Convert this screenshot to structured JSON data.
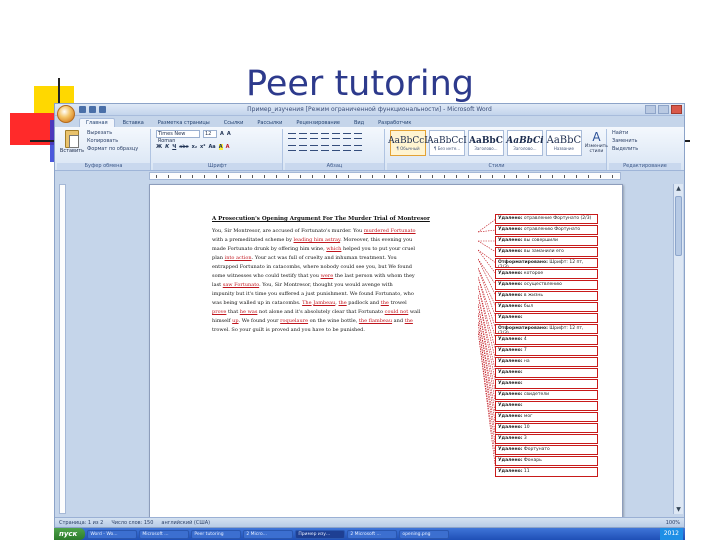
{
  "slide": {
    "title": "Peer tutoring"
  },
  "window": {
    "title": "Пример_изучения [Режим ограниченной функциональности] - Microsoft Word"
  },
  "ribbon": {
    "tabs": [
      "Главная",
      "Вставка",
      "Разметка страницы",
      "Ссылки",
      "Рассылки",
      "Рецензирование",
      "Вид",
      "Разработчик"
    ],
    "clipboard": {
      "paste": "Вставить",
      "cut": "Вырезать",
      "copy": "Копировать",
      "format_painter": "Формат по образцу",
      "label": "Буфер обмена"
    },
    "font": {
      "name": "Times New Roman",
      "size": "12",
      "format_buttons": [
        "Ж",
        "К",
        "Ч",
        "abe",
        "x₂",
        "x²",
        "Аа",
        "A"
      ],
      "label": "Шрифт"
    },
    "paragraph": {
      "label": "Абзац"
    },
    "styles": {
      "items": [
        {
          "sample": "AaBbCcI",
          "name": "¶ Обычный"
        },
        {
          "sample": "AaBbCcI",
          "name": "¶ Без инте..."
        },
        {
          "sample": "AaBbC",
          "name": "Заголово..."
        },
        {
          "sample": "AaBbCi",
          "name": "Заголово..."
        },
        {
          "sample": "AaBbC",
          "name": "Название"
        }
      ],
      "change_styles": "Изменить стили",
      "label": "Стили"
    },
    "editing": {
      "find": "Найти",
      "replace": "Заменить",
      "select": "Выделить",
      "label": "Редактирование"
    }
  },
  "document": {
    "heading": "A Prosecution's Opening Argument For The Murder Trial of Montresor",
    "lines": [
      [
        {
          "t": "You, Sir Montresor, are accused of Fortunato's murder. You "
        },
        {
          "t": "murdered Fortunato",
          "red": true
        }
      ],
      [
        {
          "t": "with a premeditated scheme by "
        },
        {
          "t": "leading him astray",
          "red": true
        },
        {
          "t": ". Moreover, this evening you"
        }
      ],
      [
        {
          "t": "made Fortunato drunk by offering him wine, "
        },
        {
          "t": "which",
          "red": true
        },
        {
          "t": " helped you to put your cruel"
        }
      ],
      [
        {
          "t": "plan "
        },
        {
          "t": "into action",
          "red": true
        },
        {
          "t": ". Your act was full of cruelty and inhuman treatment. You"
        }
      ],
      [
        {
          "t": "entrapped Fortunato in catacombs, where nobody could see you, but We found"
        }
      ],
      [
        {
          "t": "some witnesses who could testify that you "
        },
        {
          "t": "were",
          "red": true
        },
        {
          "t": " the last person with whom they"
        }
      ],
      [
        {
          "t": "last "
        },
        {
          "t": "saw Fortunato",
          "red": true
        },
        {
          "t": ". You, Sir Montresor, thought you would avenge with"
        }
      ],
      [
        {
          "t": "impunity but it's time you suffered a just punishment. We found Fortunato, who"
        }
      ],
      [
        {
          "t": "was being walled up in catacombs. "
        },
        {
          "t": "The",
          "red": true
        },
        {
          "t": " "
        },
        {
          "t": "Jambeau",
          "red": true
        },
        {
          "t": ", "
        },
        {
          "t": "the",
          "red": true
        },
        {
          "t": " padlock and "
        },
        {
          "t": "the",
          "red": true
        },
        {
          "t": " trowel"
        }
      ],
      [
        {
          "t": "prove",
          "red": true
        },
        {
          "t": " that "
        },
        {
          "t": "he was",
          "red": true
        },
        {
          "t": " not alone and it's absolutely clear that Fortunato "
        },
        {
          "t": "could not",
          "red": true
        },
        {
          "t": " wall"
        }
      ],
      [
        {
          "t": "himself "
        },
        {
          "t": "up",
          "red": true
        },
        {
          "t": ". We found your "
        },
        {
          "t": "roquelaure",
          "red": true
        },
        {
          "t": " on the wine bottle, "
        },
        {
          "t": "the flambeau",
          "red": true
        },
        {
          "t": " and "
        },
        {
          "t": "the",
          "red": true
        }
      ],
      [
        {
          "t": "trowel. So your guilt is proved and you have to be punished."
        }
      ]
    ],
    "comments": [
      {
        "label": "Удалено:",
        "text": "отравление Фортунато (2/3)"
      },
      {
        "label": "Удалено:",
        "text": "отравлению Фортунато"
      },
      {
        "label": "Удалено:",
        "text": "вы совершили"
      },
      {
        "label": "Удалено:",
        "text": "вы заманили его"
      },
      {
        "label": "Отформатировано:",
        "text": "Шрифт: 12 пт, (2/3)"
      },
      {
        "label": "Удалено:",
        "text": "которое"
      },
      {
        "label": "Удалено:",
        "text": "осуществлению"
      },
      {
        "label": "Удалено:",
        "text": "в жизнь"
      },
      {
        "label": "Удалено:",
        "text": "был"
      },
      {
        "label": "Удалено:",
        "text": ""
      },
      {
        "label": "Отформатировано:",
        "text": "Шрифт: 12 пт, (2/3)"
      },
      {
        "label": "Удалено:",
        "text": "4"
      },
      {
        "label": "Удалено:",
        "text": "7"
      },
      {
        "label": "Удалено:",
        "text": "на"
      },
      {
        "label": "Удалено:",
        "text": ""
      },
      {
        "label": "Удалено:",
        "text": ""
      },
      {
        "label": "Удалено:",
        "text": "свидетели"
      },
      {
        "label": "Удалено:",
        "text": ""
      },
      {
        "label": "Удалено:",
        "text": "мог"
      },
      {
        "label": "Удалено:",
        "text": "10"
      },
      {
        "label": "Удалено:",
        "text": "3"
      },
      {
        "label": "Удалено:",
        "text": "Фортунато"
      },
      {
        "label": "Удалено:",
        "text": "Фонарь"
      },
      {
        "label": "Удалено:",
        "text": "11"
      }
    ]
  },
  "statusbar": {
    "page": "Страница: 1 из 2",
    "words": "Число слов: 150",
    "language": "английский (США)",
    "zoom": "100%"
  },
  "taskbar": {
    "start": "пуск",
    "tasks": [
      "Word - Wo...",
      "Microsoft ...",
      "Peer tutoring",
      "2 Micro...",
      "Пример изу...",
      "2 Microsoft ...",
      "opening.png"
    ],
    "tray": "2012"
  },
  "colors": {
    "title": "#2d3a8c",
    "track_change": "#c0151d",
    "deco_yellow": "#ffd800",
    "deco_red": "#ff2a2a",
    "deco_blue": "#2b3bd6"
  }
}
